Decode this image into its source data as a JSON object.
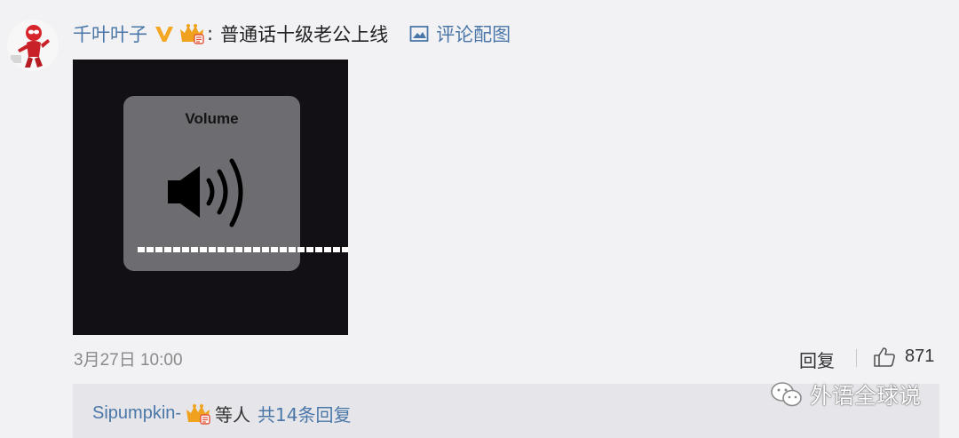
{
  "comment": {
    "username": "千叶叶子",
    "text": "普通话十级老公上线",
    "view_image_link": "评论配图",
    "image": {
      "hud_title": "Volume"
    },
    "timestamp": "3月27日 10:00",
    "reply_label": "回复",
    "like_count": "871"
  },
  "replies": {
    "first_user": "Sipumpkin-",
    "middle_text": "等人",
    "total_link": "共14条回复"
  },
  "watermark": {
    "text": "外语全球说"
  },
  "colors": {
    "link": "#4a77a8",
    "vip_badge": "#f5a623",
    "crown": "#f0a21e",
    "background": "#f2f2f5"
  },
  "icons": [
    "avatar",
    "vip-v-icon",
    "crown-badge-icon",
    "image-icon",
    "speaker-icon",
    "thumbs-up-icon",
    "wechat-icon"
  ]
}
